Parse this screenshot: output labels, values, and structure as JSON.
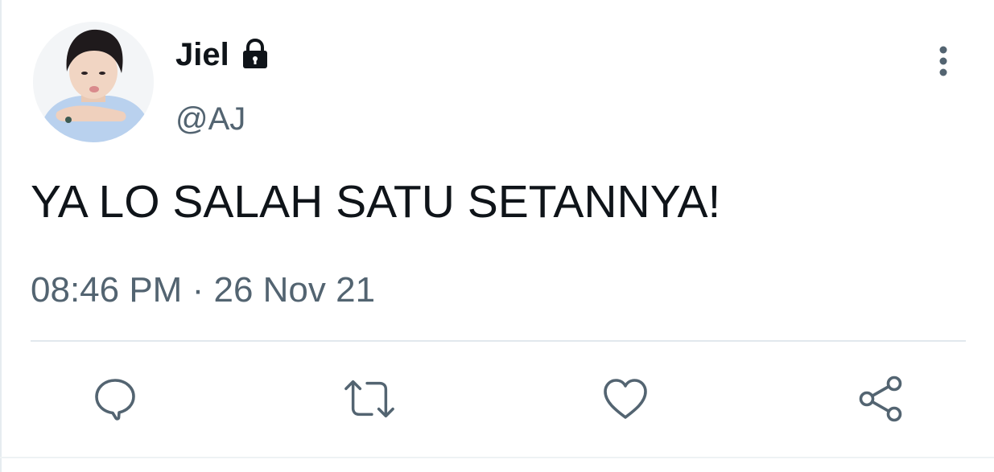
{
  "tweet": {
    "display_name": "Jiel",
    "handle": "@AJ",
    "text": "YA LO SALAH SATU SETANNYA!",
    "time": "08:46 PM",
    "separator": "·",
    "date": "26 Nov 21",
    "protected_icon": "lock-icon",
    "more_icon": "more-vertical-icon"
  },
  "actions": [
    {
      "name": "reply",
      "icon": "reply-icon"
    },
    {
      "name": "retweet",
      "icon": "retweet-icon"
    },
    {
      "name": "like",
      "icon": "heart-icon"
    },
    {
      "name": "share",
      "icon": "share-icon"
    }
  ],
  "colors": {
    "text_primary": "#0f1419",
    "text_secondary": "#536471",
    "icon": "#536471",
    "divider": "#e1e8ed",
    "background": "#ffffff"
  }
}
